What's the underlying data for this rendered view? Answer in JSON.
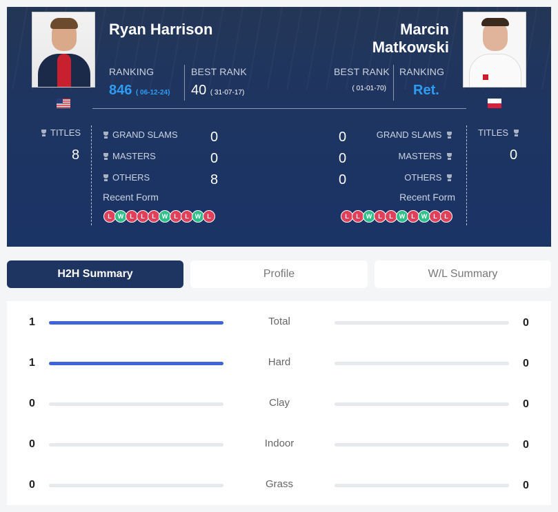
{
  "player1": {
    "name": "Ryan Harrison",
    "ranking_label": "RANKING",
    "ranking": "846",
    "ranking_date": "( 06-12-24)",
    "best_rank_label": "BEST RANK",
    "best_rank": "40",
    "best_rank_date": "( 31-07-17)",
    "titles_label": "TITLES",
    "titles": "8",
    "grand_slams_label": "GRAND SLAMS",
    "grand_slams": "0",
    "masters_label": "MASTERS",
    "masters": "0",
    "others_label": "OTHERS",
    "others": "8",
    "recent_form_label": "Recent Form",
    "recent_form": [
      "L",
      "W",
      "L",
      "L",
      "L",
      "W",
      "L",
      "L",
      "W",
      "L"
    ],
    "flag": "us-flag"
  },
  "player2": {
    "name": "Marcin Matkowski",
    "ranking_label": "RANKING",
    "ranking": "Ret.",
    "best_rank_label": "BEST RANK",
    "best_rank": "",
    "best_rank_date": "( 01-01-70)",
    "titles_label": "TITLES",
    "titles": "0",
    "grand_slams_label": "GRAND SLAMS",
    "grand_slams": "0",
    "masters_label": "MASTERS",
    "masters": "0",
    "others_label": "OTHERS",
    "others": "0",
    "recent_form_label": "Recent Form",
    "recent_form": [
      "L",
      "L",
      "W",
      "L",
      "L",
      "W",
      "L",
      "W",
      "L",
      "L"
    ],
    "flag": "poland-flag"
  },
  "tabs": [
    {
      "label": "H2H Summary",
      "active": true
    },
    {
      "label": "Profile",
      "active": false
    },
    {
      "label": "W/L Summary",
      "active": false
    }
  ],
  "h2h_rows": [
    {
      "label": "Total",
      "left": "1",
      "right": "0",
      "left_fraction": 1.0,
      "right_fraction": 0.0
    },
    {
      "label": "Hard",
      "left": "1",
      "right": "0",
      "left_fraction": 1.0,
      "right_fraction": 0.0
    },
    {
      "label": "Clay",
      "left": "0",
      "right": "0",
      "left_fraction": 0.0,
      "right_fraction": 0.0
    },
    {
      "label": "Indoor",
      "left": "0",
      "right": "0",
      "left_fraction": 0.0,
      "right_fraction": 0.0
    },
    {
      "label": "Grass",
      "left": "0",
      "right": "0",
      "left_fraction": 0.0,
      "right_fraction": 0.0
    }
  ],
  "colors": {
    "header_bg": "#1e3561",
    "accent_blue": "#2f9cf4",
    "bar_fill": "#3f63d8",
    "loss": "#e0405a",
    "win": "#2fbf8a"
  }
}
